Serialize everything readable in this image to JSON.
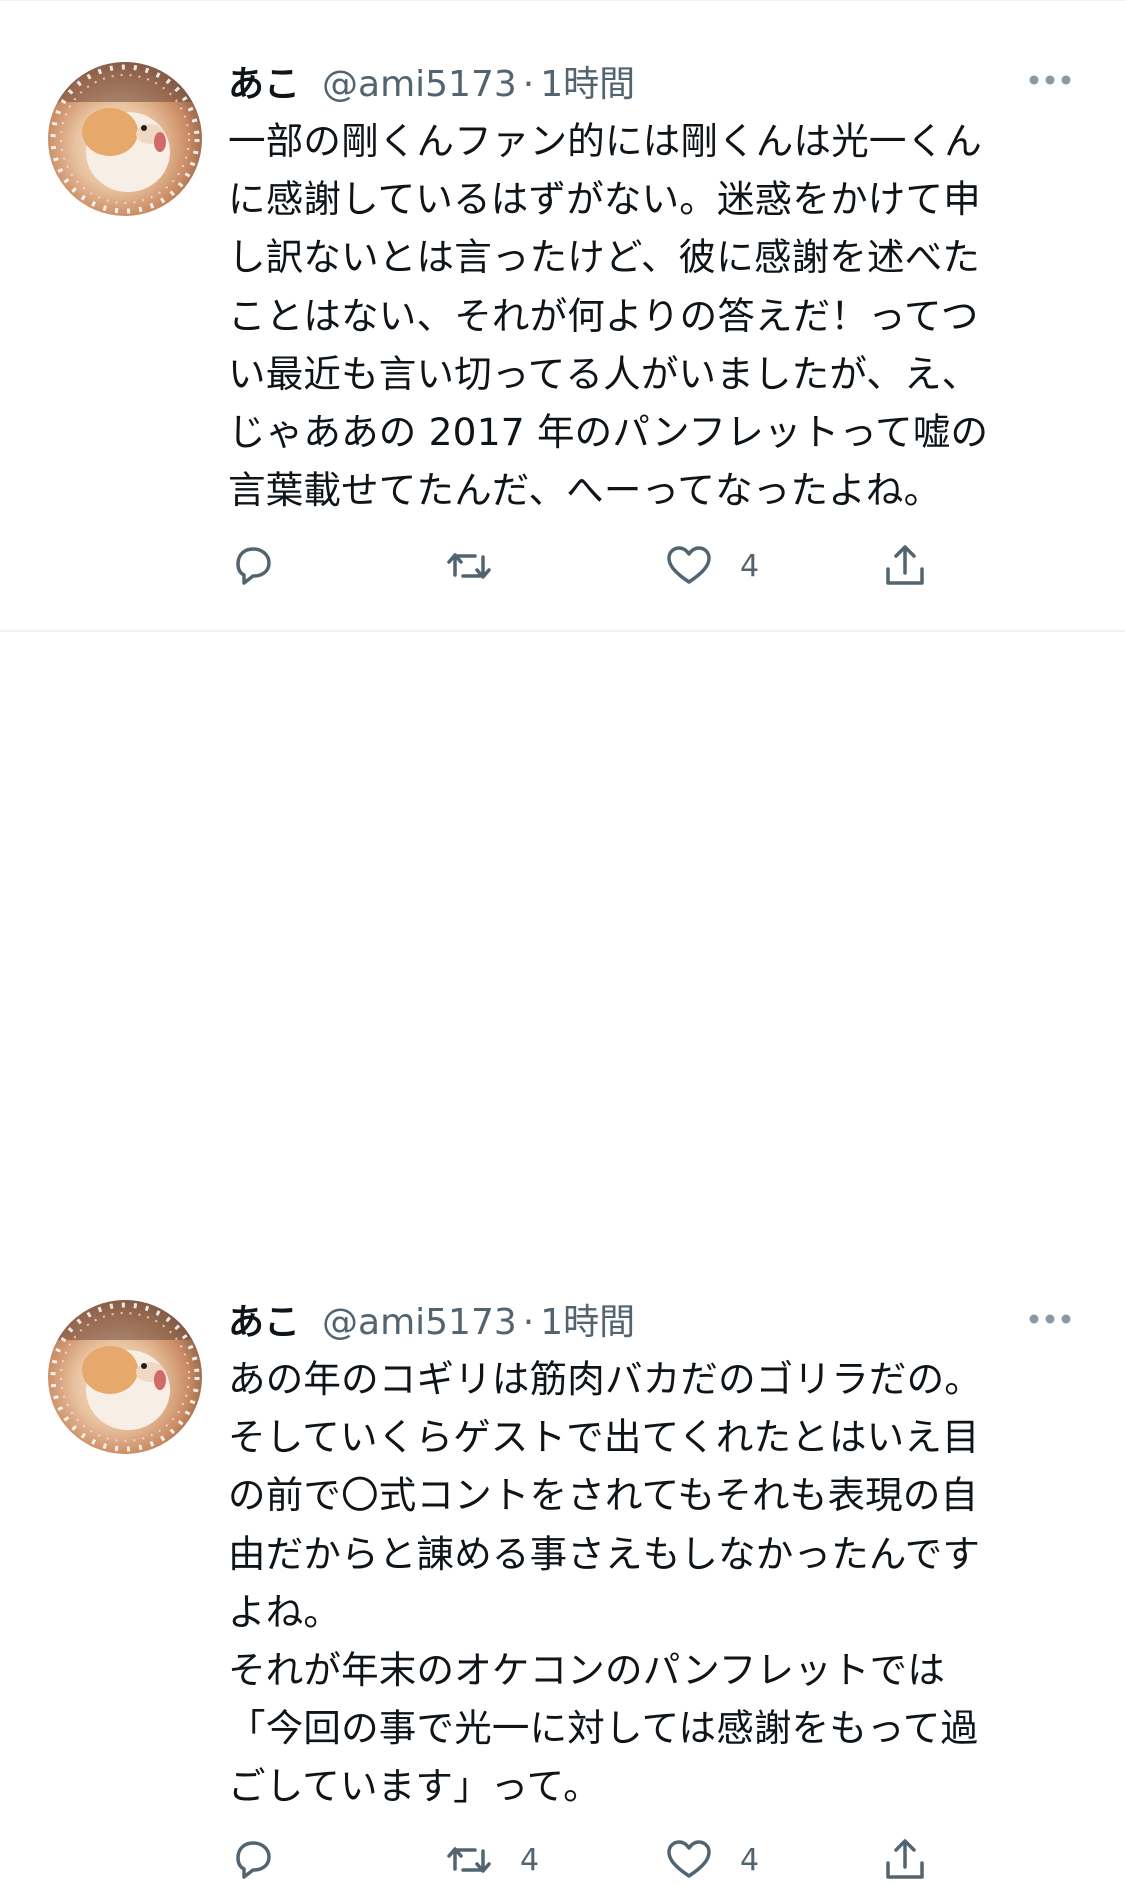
{
  "tweets": [
    {
      "author_name": "あこ",
      "author_handle": "@ami5173",
      "separator": "·",
      "timestamp": "1時間",
      "text": "一部の剛くんファン的には剛くんは光一くん\nに感謝しているはずがない。迷惑をかけて申\nし訳ないとは言ったけど、彼に感謝を述べた\nことはない、それが何よりの答えだ！ってつ\nい最近も言い切ってる人がいましたが、え、\nじゃああの 2017 年のパンフレットって嘘の\n言葉載せてたんだ、へーってなったよね。",
      "reply_count": "",
      "retweet_count": "",
      "like_count": "4"
    },
    {
      "author_name": "あこ",
      "author_handle": "@ami5173",
      "separator": "·",
      "timestamp": "1時間",
      "text": "あの年のコギリは筋肉バカだのゴリラだの。\nそしていくらゲストで出てくれたとはいえ目\nの前で〇式コントをされてもそれも表現の自\n由だからと諌める事さえもしなかったんです\nよね。\nそれが年末のオケコンのパンフレットでは\n「今回の事で光一に対しては感謝をもって過\nごしています」って。",
      "reply_count": "",
      "retweet_count": "4",
      "like_count": "4"
    }
  ],
  "icons": {
    "reply": "reply-icon",
    "retweet": "retweet-icon",
    "like": "heart-icon",
    "share": "share-icon",
    "more": "more-icon",
    "avatar": "avatar"
  },
  "colors": {
    "text_primary": "#0f1419",
    "text_secondary": "#536471",
    "divider": "#eff3f4"
  }
}
